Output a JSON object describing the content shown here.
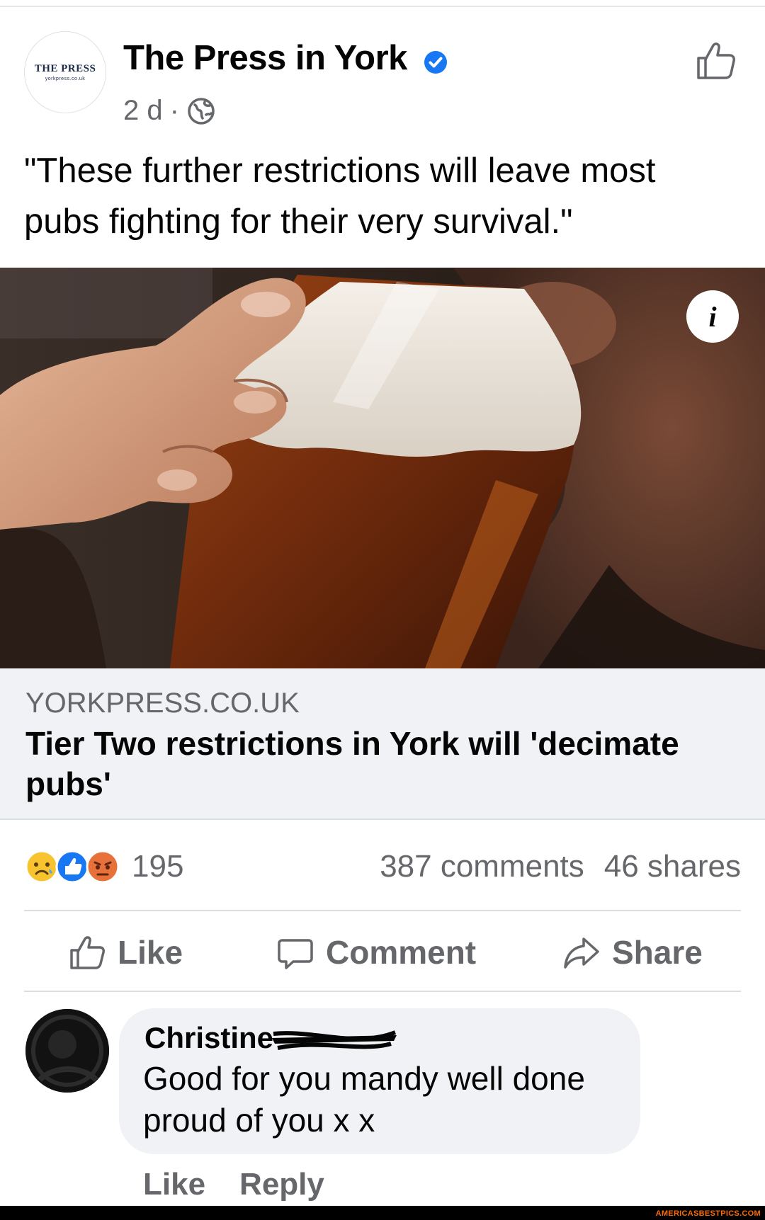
{
  "post": {
    "page_name": "The Press in York",
    "avatar_logo": "THE PRESS",
    "avatar_logo_sub": "yorkpress.co.uk",
    "time": "2 d",
    "separator": "·",
    "text": "\"These further restrictions will leave most pubs fighting for their very survival.\"",
    "verified_color": "#1877f2"
  },
  "link": {
    "domain": "YORKPRESS.CO.UK",
    "title": "Tier Two restrictions in York will 'decimate pubs'"
  },
  "image": {
    "info_glyph": "i"
  },
  "engagement": {
    "reaction_icons": [
      "sad-reaction-icon",
      "like-reaction-icon",
      "angry-reaction-icon"
    ],
    "reaction_count": "195",
    "comments": "387 comments",
    "shares": "46 shares"
  },
  "actions": {
    "like": "Like",
    "comment": "Comment",
    "share": "Share"
  },
  "comment": {
    "author_first": "Christine",
    "text": "Good for you mandy well done proud of you x x",
    "like": "Like",
    "reply": "Reply"
  },
  "footer": {
    "watermark": "AMERICASBESTPICS.COM"
  }
}
